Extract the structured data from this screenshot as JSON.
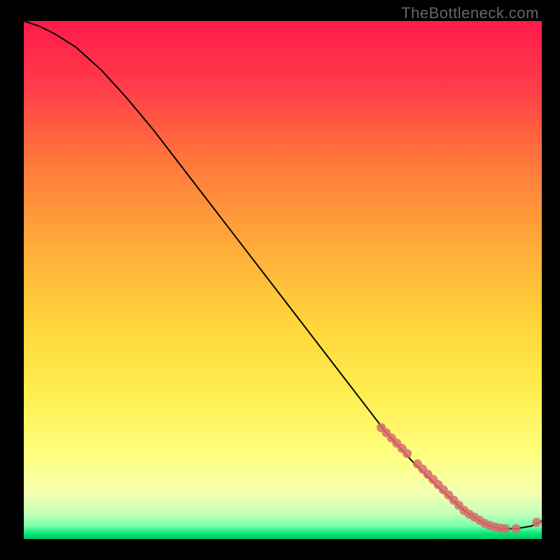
{
  "watermark": "TheBottleneck.com",
  "chart_data": {
    "type": "line",
    "title": "",
    "xlabel": "",
    "ylabel": "",
    "xlim": [
      0,
      100
    ],
    "ylim": [
      0,
      100
    ],
    "background_gradient": {
      "top": "#ff1a4a",
      "upper_mid": "#ff7a3a",
      "mid": "#ffd43a",
      "lower_mid": "#ffff66",
      "lower": "#d4ff8c",
      "bottom_band": "#00e676"
    },
    "series": [
      {
        "name": "curve",
        "type": "line",
        "color": "#000000",
        "x": [
          0,
          3,
          6,
          10,
          15,
          20,
          25,
          30,
          35,
          40,
          45,
          50,
          55,
          60,
          65,
          70,
          75,
          80,
          85,
          88,
          90,
          92,
          95,
          98,
          100
        ],
        "y": [
          100,
          99,
          97.5,
          95,
          90.5,
          85,
          79,
          72.5,
          66,
          59.5,
          53,
          46.5,
          40,
          33.5,
          27,
          20.5,
          15,
          10,
          5.5,
          3.5,
          2.5,
          2,
          2,
          2.5,
          3.5
        ]
      },
      {
        "name": "points",
        "type": "scatter",
        "color": "#d86b6b",
        "x": [
          69,
          70,
          71,
          72,
          73,
          74,
          76,
          77,
          78,
          79,
          80,
          81,
          82,
          83,
          84,
          85,
          86,
          87,
          88,
          89,
          90,
          91,
          92,
          93,
          95,
          99
        ],
        "y": [
          21.5,
          20.5,
          19.5,
          18.5,
          17.5,
          16.5,
          14.5,
          13.5,
          12.5,
          11.5,
          10.5,
          9.5,
          8.5,
          7.5,
          6.5,
          5.5,
          4.8,
          4.2,
          3.6,
          3,
          2.6,
          2.3,
          2.1,
          2,
          2,
          3.2
        ]
      }
    ]
  }
}
